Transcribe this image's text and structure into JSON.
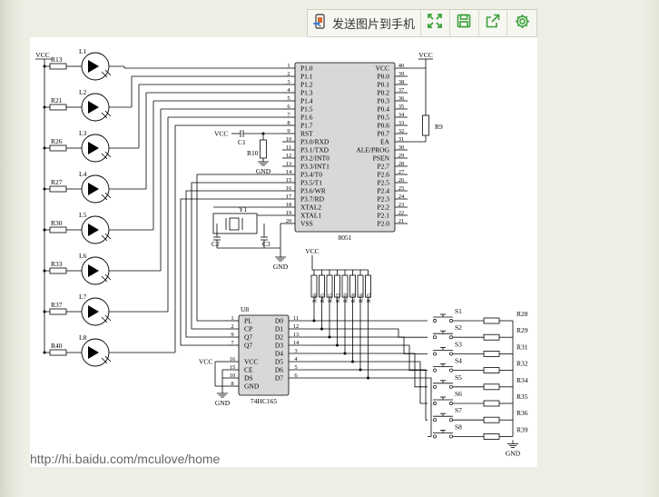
{
  "toolbar": {
    "send_label": "发送图片到手机",
    "icons": [
      "phone-send-icon",
      "fullscreen-icon",
      "save-icon",
      "share-icon",
      "settings-icon"
    ],
    "accent": "#3aa13a"
  },
  "image": {
    "watermark": "http://hi.baidu.com/mculove/home"
  },
  "schematic": {
    "vcc": "VCC",
    "gnd": "GND",
    "mcu": {
      "name": "8051",
      "left_pins": [
        {
          "n": "1",
          "name": "P1.0"
        },
        {
          "n": "2",
          "name": "P1.1"
        },
        {
          "n": "3",
          "name": "P1.2"
        },
        {
          "n": "4",
          "name": "P1.3"
        },
        {
          "n": "5",
          "name": "P1.4"
        },
        {
          "n": "6",
          "name": "P1.5"
        },
        {
          "n": "7",
          "name": "P1.6"
        },
        {
          "n": "8",
          "name": "P1.7"
        },
        {
          "n": "9",
          "name": "RST"
        },
        {
          "n": "10",
          "name": "P3.0/RXD"
        },
        {
          "n": "11",
          "name": "P3.1/TXD"
        },
        {
          "n": "12",
          "name": "P3.2/INT0"
        },
        {
          "n": "13",
          "name": "P3.3/INT1"
        },
        {
          "n": "14",
          "name": "P3.4/T0"
        },
        {
          "n": "15",
          "name": "P3.5/T1"
        },
        {
          "n": "16",
          "name": "P3.6/WR"
        },
        {
          "n": "17",
          "name": "P3.7/RD"
        },
        {
          "n": "18",
          "name": "XTAL2"
        },
        {
          "n": "19",
          "name": "XTAL1"
        },
        {
          "n": "20",
          "name": "VSS"
        }
      ],
      "right_pins": [
        {
          "n": "40",
          "name": "VCC"
        },
        {
          "n": "39",
          "name": "P0.0"
        },
        {
          "n": "38",
          "name": "P0.1"
        },
        {
          "n": "37",
          "name": "P0.2"
        },
        {
          "n": "36",
          "name": "P0.3"
        },
        {
          "n": "35",
          "name": "P0.4"
        },
        {
          "n": "34",
          "name": "P0.5"
        },
        {
          "n": "33",
          "name": "P0.6"
        },
        {
          "n": "32",
          "name": "P0.7"
        },
        {
          "n": "31",
          "name": "EA"
        },
        {
          "n": "30",
          "name": "ALE/PROG"
        },
        {
          "n": "29",
          "name": "PSEN"
        },
        {
          "n": "28",
          "name": "P2.7"
        },
        {
          "n": "27",
          "name": "P2.6"
        },
        {
          "n": "26",
          "name": "P2.5"
        },
        {
          "n": "25",
          "name": "P2.4"
        },
        {
          "n": "24",
          "name": "P2.3"
        },
        {
          "n": "23",
          "name": "P2.2"
        },
        {
          "n": "22",
          "name": "P2.1"
        },
        {
          "n": "21",
          "name": "P2.0"
        }
      ]
    },
    "leds": [
      {
        "name": "L1",
        "res": "R13"
      },
      {
        "name": "L2",
        "res": "R21"
      },
      {
        "name": "L3",
        "res": "R26"
      },
      {
        "name": "L4",
        "res": "R27"
      },
      {
        "name": "L5",
        "res": "R30"
      },
      {
        "name": "L6",
        "res": "R33"
      },
      {
        "name": "L7",
        "res": "R37"
      },
      {
        "name": "L8",
        "res": "R40"
      }
    ],
    "misc": {
      "r9": "R9",
      "r10": "R10",
      "c1": "C1",
      "c2": "C2",
      "c3": "C3",
      "y1": "Y1"
    },
    "pullups": [
      "R46",
      "R45",
      "R25",
      "R23",
      "R20",
      "R18",
      "R16",
      "R15"
    ],
    "shift": {
      "name": "74HC165",
      "ref": "U8",
      "left_pins": [
        {
          "n": "1",
          "name": "PL"
        },
        {
          "n": "2",
          "name": "CP"
        },
        {
          "n": "9",
          "name": "Q7"
        },
        {
          "n": "7",
          "name": "Q7"
        },
        {
          "n": "16",
          "name": "VCC"
        },
        {
          "n": "15",
          "name": "CE"
        },
        {
          "n": "10",
          "name": "DS"
        },
        {
          "n": "8",
          "name": "GND"
        }
      ],
      "right_pins": [
        {
          "n": "11",
          "name": "D0"
        },
        {
          "n": "12",
          "name": "D1"
        },
        {
          "n": "13",
          "name": "D2"
        },
        {
          "n": "14",
          "name": "D3"
        },
        {
          "n": "3",
          "name": "D4"
        },
        {
          "n": "4",
          "name": "D5"
        },
        {
          "n": "5",
          "name": "D6"
        },
        {
          "n": "6",
          "name": "D7"
        }
      ]
    },
    "switches": [
      {
        "sw": "S1",
        "res": "R28"
      },
      {
        "sw": "S2",
        "res": "R29"
      },
      {
        "sw": "S3",
        "res": "R31"
      },
      {
        "sw": "S4",
        "res": "R32"
      },
      {
        "sw": "S5",
        "res": "R34"
      },
      {
        "sw": "S6",
        "res": "R35"
      },
      {
        "sw": "S7",
        "res": "R36"
      },
      {
        "sw": "S8",
        "res": "R39"
      }
    ]
  }
}
